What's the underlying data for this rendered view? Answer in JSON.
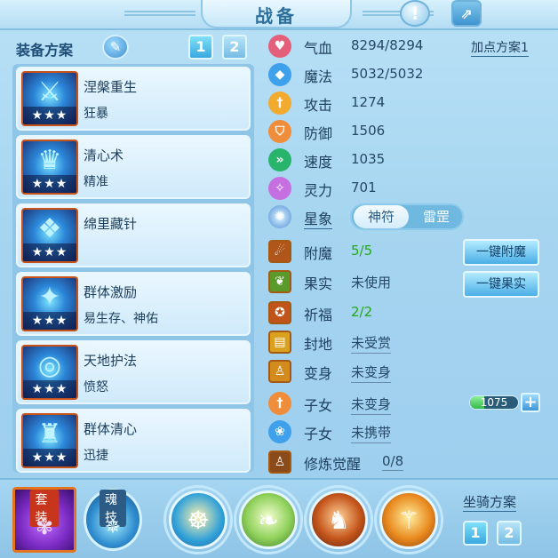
{
  "window": {
    "title": "战备"
  },
  "equip_plan": {
    "label": "装备方案",
    "plan_buttons": [
      "1",
      "2"
    ]
  },
  "equipment": [
    {
      "name": "涅槃重生",
      "effect": "狂暴",
      "stars": "★★★"
    },
    {
      "name": "清心术",
      "effect": "精准",
      "stars": "★★★"
    },
    {
      "name": "绵里藏针",
      "effect": "",
      "stars": "★★★"
    },
    {
      "name": "群体激励",
      "effect": "易生存、神佑",
      "stars": "★★★"
    },
    {
      "name": "天地护法",
      "effect": "愤怒",
      "stars": "★★★"
    },
    {
      "name": "群体清心",
      "effect": "迅捷",
      "stars": "★★★"
    }
  ],
  "stats": {
    "point_plan": "加点方案1",
    "items": [
      {
        "label": "气血",
        "value": "8294/8294",
        "color": "#e4607a",
        "icon": "heart-icon"
      },
      {
        "label": "魔法",
        "value": "5032/5032",
        "color": "#3fa0ec",
        "icon": "diamond-icon"
      },
      {
        "label": "攻击",
        "value": "1274",
        "color": "#f2ab2e",
        "icon": "sword-icon"
      },
      {
        "label": "防御",
        "value": "1506",
        "color": "#f08d3a",
        "icon": "shield-icon"
      },
      {
        "label": "速度",
        "value": "1035",
        "color": "#28b56b",
        "icon": "speed-icon"
      },
      {
        "label": "灵力",
        "value": "701",
        "color": "#c66fe0",
        "icon": "spirit-icon"
      }
    ]
  },
  "constellation": {
    "label": "星象",
    "options": [
      "神符",
      "雷罡"
    ],
    "selected": "神符"
  },
  "enhance": {
    "enchant": {
      "label": "附魔",
      "value": "5/5",
      "button": "一键附魔"
    },
    "fruit": {
      "label": "果实",
      "value": "未使用",
      "button": "一键果实"
    },
    "blessing": {
      "label": "祈福",
      "value": "2/2"
    },
    "seal": {
      "label": "封地",
      "value": "未受赏"
    },
    "transform": {
      "label": "变身",
      "value": "未变身"
    },
    "child1": {
      "label": "子女",
      "value": "未变身",
      "exp_value": "1075"
    },
    "child2": {
      "label": "子女",
      "value": "未携带"
    },
    "awaken": {
      "label": "修炼觉醒",
      "value": "0/8"
    }
  },
  "bottom": {
    "suit_label": "套装",
    "soul_label": "魂技",
    "mount_plan_label": "坐骑方案",
    "mount_buttons": [
      "1",
      "2"
    ]
  },
  "colors": {
    "panel": "#a6d5f0",
    "accent": "#3e96d8",
    "green": "#24a81a",
    "title": "#2b6f9c"
  }
}
